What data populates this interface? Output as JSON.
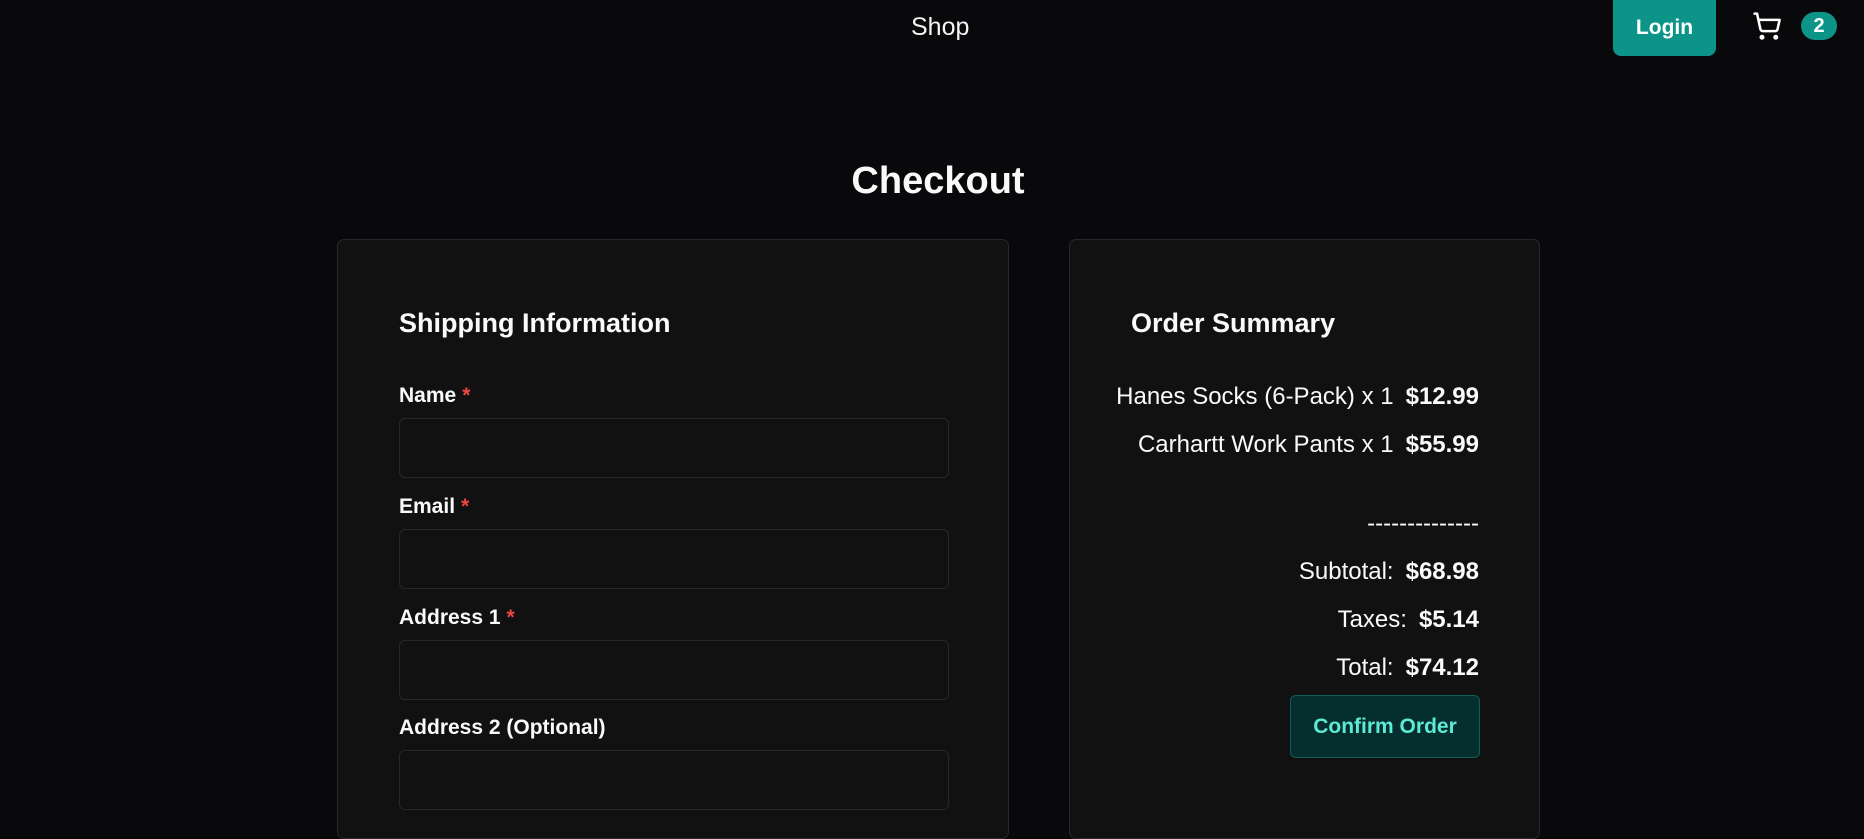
{
  "header": {
    "shop_label": "Shop",
    "login_label": "Login",
    "cart_count": "2",
    "cart_icon": "shopping-cart-icon",
    "accent_color": "#0d9488"
  },
  "page": {
    "title": "Checkout"
  },
  "shipping": {
    "heading": "Shipping Information",
    "required_marker": "*",
    "fields": [
      {
        "label": "Name",
        "required": true,
        "value": ""
      },
      {
        "label": "Email",
        "required": true,
        "value": ""
      },
      {
        "label": "Address 1",
        "required": true,
        "value": ""
      },
      {
        "label": "Address 2 (Optional)",
        "required": false,
        "value": ""
      }
    ]
  },
  "summary": {
    "heading": "Order Summary",
    "items": [
      {
        "name": "Hanes Socks (6-Pack) x 1",
        "price": "$12.99"
      },
      {
        "name": "Carhartt Work Pants x 1",
        "price": "$55.99"
      }
    ],
    "divider": "--------------",
    "subtotal_label": "Subtotal:",
    "subtotal_value": "$68.98",
    "taxes_label": "Taxes:",
    "taxes_value": "$5.14",
    "total_label": "Total:",
    "total_value": "$74.12",
    "confirm_label": "Confirm Order"
  }
}
